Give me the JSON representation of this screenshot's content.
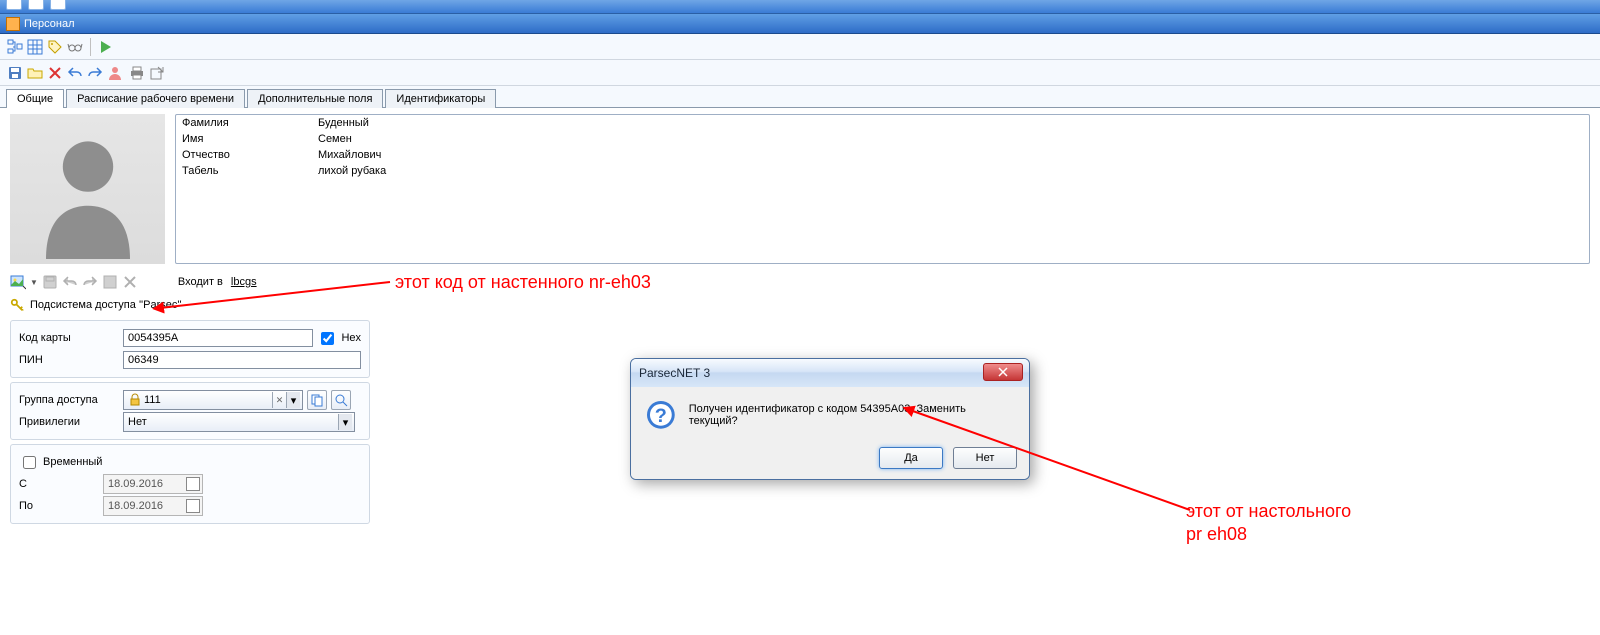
{
  "window_title": "Персонал",
  "tabs": [
    {
      "label": "Общие",
      "active": true
    },
    {
      "label": "Расписание рабочего времени",
      "active": false
    },
    {
      "label": "Дополнительные поля",
      "active": false
    },
    {
      "label": "Идентификаторы",
      "active": false
    }
  ],
  "person_info": [
    {
      "label": "Фамилия",
      "value": "Буденный"
    },
    {
      "label": "Имя",
      "value": "Семен"
    },
    {
      "label": "Отчество",
      "value": "Михайлович"
    },
    {
      "label": "Табель",
      "value": "лихой рубака"
    }
  ],
  "enters_in_label": "Входит в",
  "enters_in_value": "lbcgs",
  "subsystem_label": "Подсистема доступа ''Parsec''",
  "card_group": {
    "card_code_label": "Код карты",
    "card_code_value": "0054395A",
    "hex_label": "Hex",
    "hex_checked": true,
    "pin_label": "ПИН",
    "pin_value": "06349"
  },
  "access_group": {
    "group_label": "Группа доступа",
    "group_value": "111",
    "priv_label": "Привилегии",
    "priv_value": "Нет"
  },
  "temp_group": {
    "temp_label": "Временный",
    "from_label": "С",
    "from_value": "18.09.2016",
    "to_label": "По",
    "to_value": "18.09.2016"
  },
  "dialog": {
    "title": "ParsecNET 3",
    "message": "Получен идентификатор с кодом 54395A03. Заменить текущий?",
    "yes": "Да",
    "no": "Нет"
  },
  "annotations": {
    "top_text": "этот код от настенного nr-eh03",
    "bottom_text_line1": "этот от настольного",
    "bottom_text_line2": "pr eh08"
  }
}
